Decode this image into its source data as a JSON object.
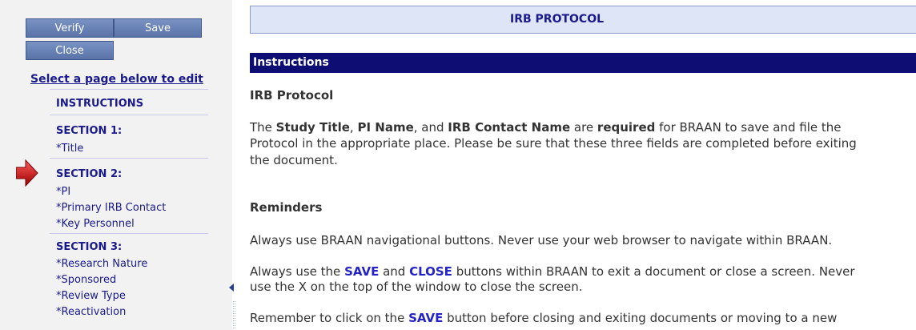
{
  "toolbar": {
    "verify_label": "Verify",
    "save_label": "Save",
    "close_label": "Close"
  },
  "sidebar": {
    "title": "Select a page below to edit",
    "instructions": "INSTRUCTIONS",
    "sections": [
      {
        "heading": "SECTION 1:",
        "items": [
          "*Title"
        ]
      },
      {
        "heading": "SECTION 2:",
        "items": [
          "*PI",
          "*Primary IRB Contact",
          "*Key Personnel"
        ]
      },
      {
        "heading": "SECTION 3:",
        "items": [
          "*Research Nature",
          "*Sponsored",
          "*Review Type",
          "*Reactivation"
        ]
      }
    ],
    "current_section_index": 1
  },
  "header": {
    "title": "IRB PROTOCOL"
  },
  "main": {
    "bar_title": "Instructions",
    "irb_heading": "IRB Protocol",
    "para1": {
      "the": "The ",
      "study_title": "Study Title",
      "comma1": ", ",
      "pi_name": "PI Name",
      "and": ", and ",
      "irb_contact": "IRB Contact Name",
      "are": " are ",
      "required": "required",
      "rest_line1": " for BRAAN to save and file the",
      "line2": "Protocol in the appropriate place. Please be sure that these three fields are completed before exiting",
      "line3": "the document."
    },
    "reminders_heading": "Reminders",
    "reminder1": "Always use BRAAN navigational buttons. Never use your web browser to navigate within BRAAN.",
    "reminder2": {
      "a": "Always use the ",
      "save": "SAVE",
      "and": " and ",
      "close": "CLOSE",
      "b": " buttons within BRAAN to exit a document or close a screen. Never",
      "line2": "use the X on the top of the window to close the screen."
    },
    "reminder3": {
      "a": "Remember to click on the ",
      "save": "SAVE",
      "b": " button before closing and exiting documents or moving to a new"
    }
  },
  "colors": {
    "nav_text": "#1a1a8c",
    "button_bg": "#6b84b8",
    "bar_bg": "#0d0d73",
    "header_bg": "#dde5f7",
    "keyword": "#2323c8",
    "arrow": "#cc0000"
  }
}
